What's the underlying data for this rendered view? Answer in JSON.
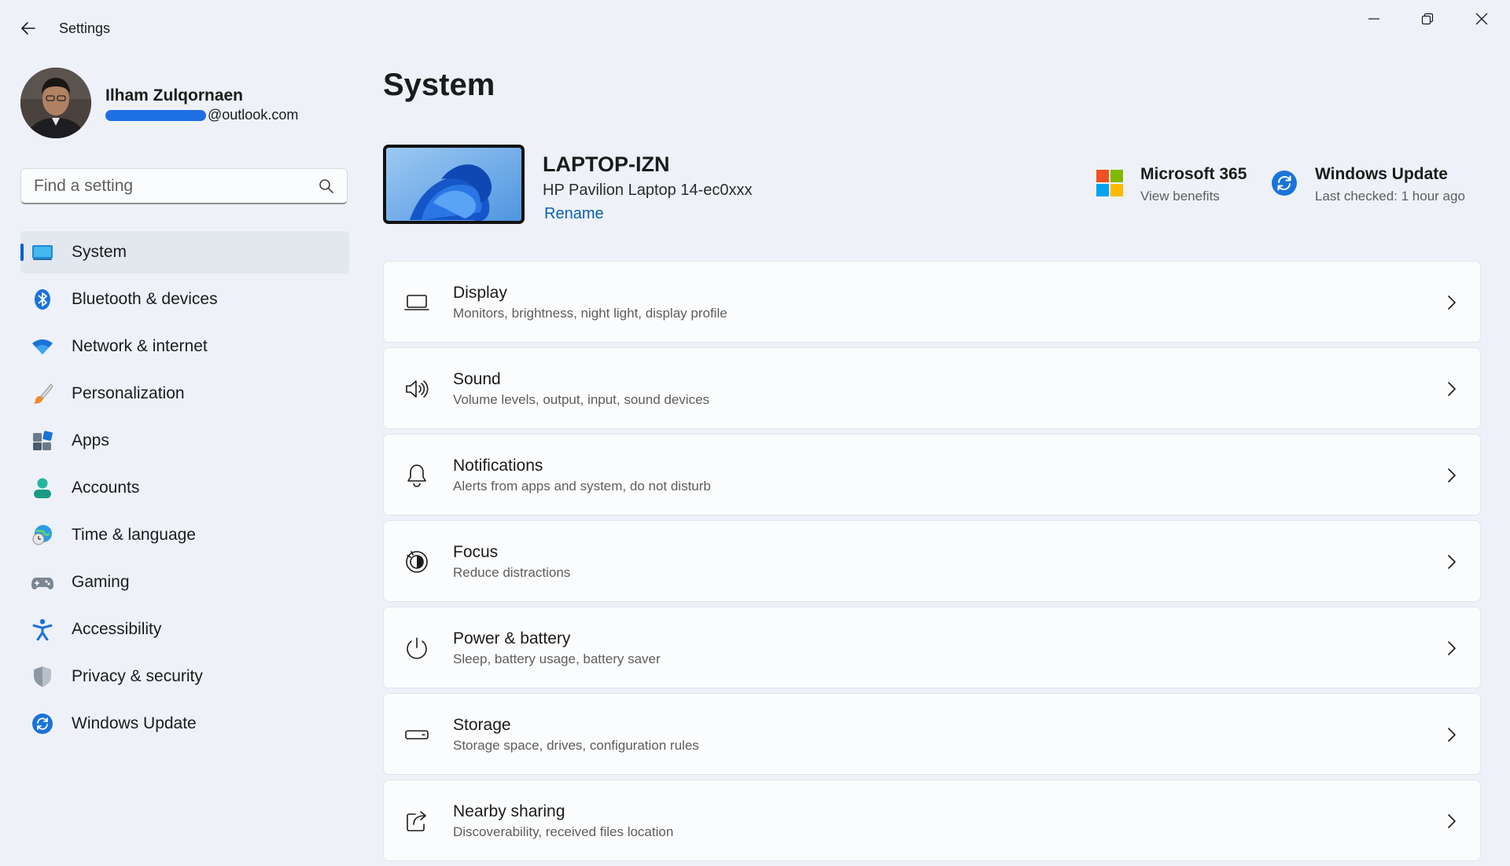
{
  "window": {
    "title": "Settings"
  },
  "profile": {
    "name": "Ilham Zulqornaen",
    "email_visible": "@outlook.com"
  },
  "search": {
    "placeholder": "Find a setting"
  },
  "sidebar": {
    "items": [
      {
        "label": "System",
        "icon": "system-icon",
        "active": true
      },
      {
        "label": "Bluetooth & devices",
        "icon": "bluetooth-icon"
      },
      {
        "label": "Network & internet",
        "icon": "wifi-icon"
      },
      {
        "label": "Personalization",
        "icon": "paintbrush-icon"
      },
      {
        "label": "Apps",
        "icon": "apps-icon"
      },
      {
        "label": "Accounts",
        "icon": "accounts-icon"
      },
      {
        "label": "Time & language",
        "icon": "globe-clock-icon"
      },
      {
        "label": "Gaming",
        "icon": "gamepad-icon"
      },
      {
        "label": "Accessibility",
        "icon": "accessibility-icon"
      },
      {
        "label": "Privacy & security",
        "icon": "shield-icon"
      },
      {
        "label": "Windows Update",
        "icon": "update-icon"
      }
    ]
  },
  "main": {
    "title": "System",
    "device": {
      "name": "LAPTOP-IZN",
      "model": "HP Pavilion Laptop 14-ec0xxx",
      "rename_label": "Rename"
    },
    "tiles": [
      {
        "title": "Microsoft 365",
        "subtitle": "View benefits",
        "icon": "microsoft-logo-icon"
      },
      {
        "title": "Windows Update",
        "subtitle": "Last checked: 1 hour ago",
        "icon": "update-icon"
      }
    ],
    "cards": [
      {
        "title": "Display",
        "subtitle": "Monitors, brightness, night light, display profile",
        "icon": "display-icon"
      },
      {
        "title": "Sound",
        "subtitle": "Volume levels, output, input, sound devices",
        "icon": "speaker-icon"
      },
      {
        "title": "Notifications",
        "subtitle": "Alerts from apps and system, do not disturb",
        "icon": "bell-icon"
      },
      {
        "title": "Focus",
        "subtitle": "Reduce distractions",
        "icon": "focus-icon"
      },
      {
        "title": "Power & battery",
        "subtitle": "Sleep, battery usage, battery saver",
        "icon": "power-icon"
      },
      {
        "title": "Storage",
        "subtitle": "Storage space, drives, configuration rules",
        "icon": "storage-icon"
      },
      {
        "title": "Nearby sharing",
        "subtitle": "Discoverability, received files location",
        "icon": "share-icon"
      }
    ]
  },
  "colors": {
    "background": "#eef2f8",
    "accent": "#0a5fcf",
    "link": "#0a5fb5"
  }
}
